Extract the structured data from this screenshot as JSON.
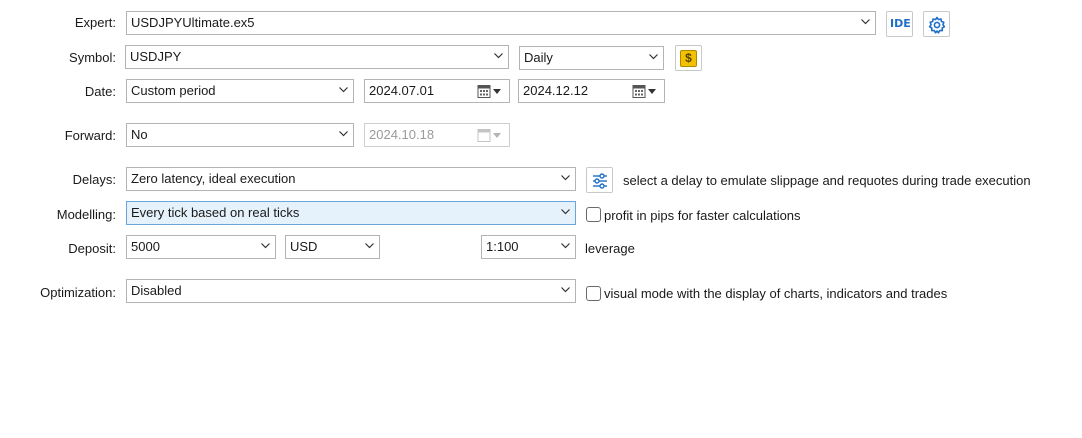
{
  "expert": {
    "label": "Expert:",
    "value": "USDJPYUltimate.ex5",
    "ide_label": "IDE"
  },
  "symbol": {
    "label": "Symbol:",
    "value": "USDJPY",
    "period": "Daily"
  },
  "date": {
    "label": "Date:",
    "mode": "Custom period",
    "from": "2024.07.01",
    "to": "2024.12.12"
  },
  "forward": {
    "label": "Forward:",
    "value": "No",
    "date": "2024.10.18"
  },
  "delays": {
    "label": "Delays:",
    "value": "Zero latency, ideal execution",
    "hint": "select a delay to emulate slippage and requotes during trade execution"
  },
  "modelling": {
    "label": "Modelling:",
    "value": "Every tick based on real ticks",
    "pips_option": "profit in pips for faster calculations",
    "pips_checked": false
  },
  "deposit": {
    "label": "Deposit:",
    "amount": "5000",
    "currency": "USD",
    "leverage": "1:100",
    "leverage_label": "leverage"
  },
  "optimization": {
    "label": "Optimization:",
    "value": "Disabled",
    "visual_option": "visual mode with the display of charts, indicators and trades",
    "visual_checked": false
  },
  "colors": {
    "accent": "#1e6fc8",
    "symbol_btn": "#f2c200",
    "focus_bg": "#e5f1fb"
  }
}
